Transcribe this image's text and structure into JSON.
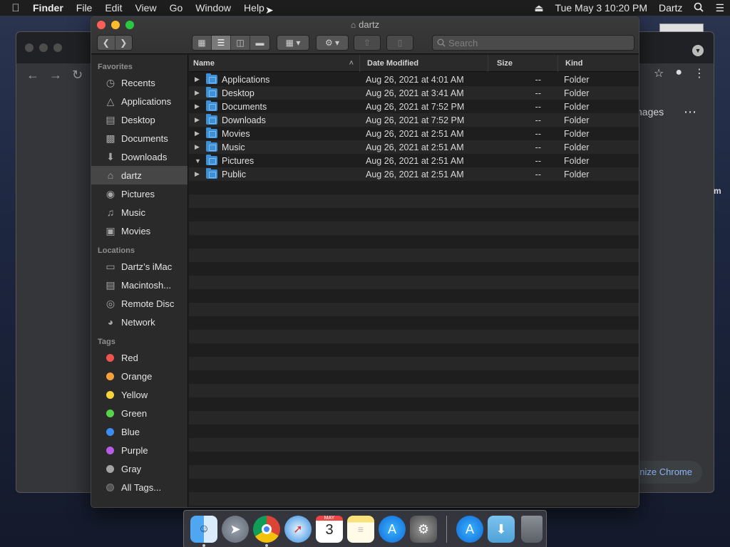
{
  "menubar": {
    "app": "Finder",
    "items": [
      "File",
      "Edit",
      "View",
      "Go",
      "Window",
      "Help"
    ],
    "clock": "Tue May 3  10:20 PM",
    "user": "Dartz"
  },
  "chrome_bg": {
    "images_link": "nages",
    "edge_letter": "m",
    "customize": "nize Chrome"
  },
  "finder": {
    "title": "dartz",
    "search_placeholder": "Search",
    "columns": {
      "name": "Name",
      "date": "Date Modified",
      "size": "Size",
      "kind": "Kind"
    },
    "rows": [
      {
        "name": "Applications",
        "date": "Aug 26, 2021 at 4:01 AM",
        "size": "--",
        "kind": "Folder",
        "expanded": false
      },
      {
        "name": "Desktop",
        "date": "Aug 26, 2021 at 3:41 AM",
        "size": "--",
        "kind": "Folder",
        "expanded": false
      },
      {
        "name": "Documents",
        "date": "Aug 26, 2021 at 7:52 PM",
        "size": "--",
        "kind": "Folder",
        "expanded": false
      },
      {
        "name": "Downloads",
        "date": "Aug 26, 2021 at 7:52 PM",
        "size": "--",
        "kind": "Folder",
        "expanded": false
      },
      {
        "name": "Movies",
        "date": "Aug 26, 2021 at 2:51 AM",
        "size": "--",
        "kind": "Folder",
        "expanded": false
      },
      {
        "name": "Music",
        "date": "Aug 26, 2021 at 2:51 AM",
        "size": "--",
        "kind": "Folder",
        "expanded": false
      },
      {
        "name": "Pictures",
        "date": "Aug 26, 2021 at 2:51 AM",
        "size": "--",
        "kind": "Folder",
        "expanded": true
      },
      {
        "name": "Public",
        "date": "Aug 26, 2021 at 2:51 AM",
        "size": "--",
        "kind": "Folder",
        "expanded": false
      }
    ]
  },
  "sidebar": {
    "favorites_label": "Favorites",
    "favorites": [
      {
        "label": "Recents",
        "icon": "clock-icon",
        "selected": false
      },
      {
        "label": "Applications",
        "icon": "applications-icon",
        "selected": false
      },
      {
        "label": "Desktop",
        "icon": "desktop-icon",
        "selected": false
      },
      {
        "label": "Documents",
        "icon": "documents-icon",
        "selected": false
      },
      {
        "label": "Downloads",
        "icon": "downloads-icon",
        "selected": false
      },
      {
        "label": "dartz",
        "icon": "home-icon",
        "selected": true
      },
      {
        "label": "Pictures",
        "icon": "camera-icon",
        "selected": false
      },
      {
        "label": "Music",
        "icon": "music-note-icon",
        "selected": false
      },
      {
        "label": "Movies",
        "icon": "film-icon",
        "selected": false
      }
    ],
    "locations_label": "Locations",
    "locations": [
      {
        "label": "Dartz’s iMac",
        "icon": "imac-icon"
      },
      {
        "label": "Macintosh...",
        "icon": "hard-drive-icon"
      },
      {
        "label": "Remote Disc",
        "icon": "disc-icon"
      },
      {
        "label": "Network",
        "icon": "globe-icon"
      }
    ],
    "tags_label": "Tags",
    "tags": [
      {
        "label": "Red",
        "color": "#f0524f"
      },
      {
        "label": "Orange",
        "color": "#f6a03b"
      },
      {
        "label": "Yellow",
        "color": "#f5d33a"
      },
      {
        "label": "Green",
        "color": "#55d34a"
      },
      {
        "label": "Blue",
        "color": "#3a8df5"
      },
      {
        "label": "Purple",
        "color": "#b75ce6"
      },
      {
        "label": "Gray",
        "color": "#a3a3a3"
      },
      {
        "label": "All Tags...",
        "color": "#555555"
      }
    ]
  },
  "dock": {
    "apps": [
      "finder-icon",
      "launchpad-icon",
      "chrome-icon",
      "safari-icon",
      "calendar-icon",
      "notes-icon",
      "app-store-icon",
      "system-preferences-icon"
    ],
    "calendar_month": "MAY",
    "calendar_day": "3",
    "others": [
      "app-store-download-icon",
      "downloads-folder-icon",
      "trash-icon"
    ]
  }
}
